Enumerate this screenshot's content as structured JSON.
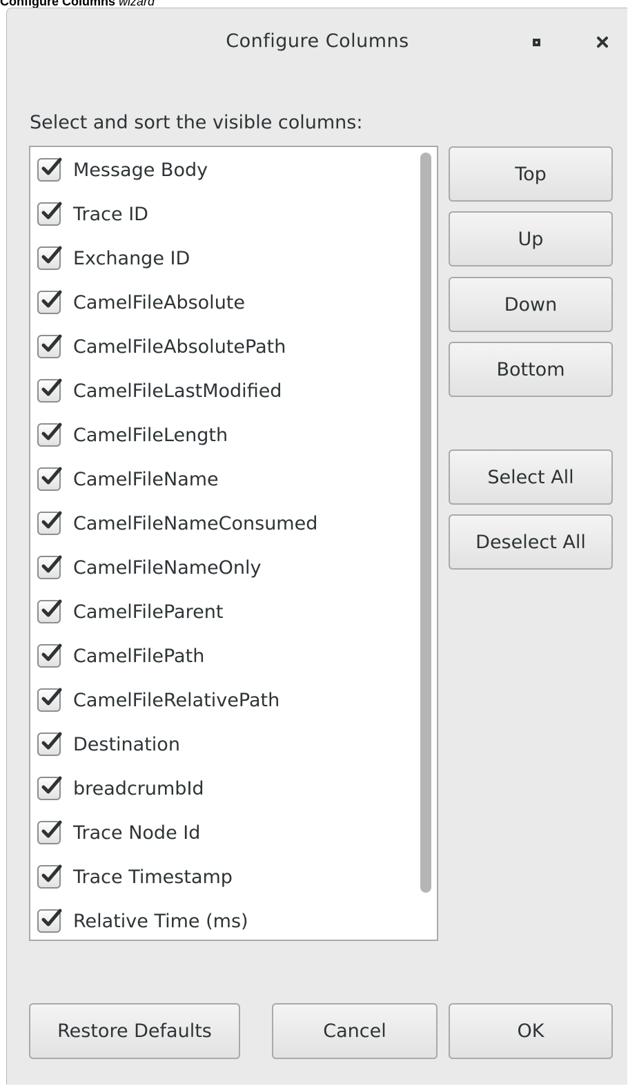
{
  "caption": {
    "bold": "Configure Columns",
    "rest": " wizard"
  },
  "dialog": {
    "title": "Configure Columns",
    "instruction": "Select and sort the visible columns:",
    "icons": {
      "maximize": "maximize-icon",
      "close": "close-icon",
      "checkbox": "check-icon"
    },
    "columns": [
      {
        "label": "Message Body",
        "checked": true
      },
      {
        "label": "Trace ID",
        "checked": true
      },
      {
        "label": "Exchange ID",
        "checked": true
      },
      {
        "label": "CamelFileAbsolute",
        "checked": true
      },
      {
        "label": "CamelFileAbsolutePath",
        "checked": true
      },
      {
        "label": "CamelFileLastModified",
        "checked": true
      },
      {
        "label": "CamelFileLength",
        "checked": true
      },
      {
        "label": "CamelFileName",
        "checked": true
      },
      {
        "label": "CamelFileNameConsumed",
        "checked": true
      },
      {
        "label": "CamelFileNameOnly",
        "checked": true
      },
      {
        "label": "CamelFileParent",
        "checked": true
      },
      {
        "label": "CamelFilePath",
        "checked": true
      },
      {
        "label": "CamelFileRelativePath",
        "checked": true
      },
      {
        "label": "Destination",
        "checked": true
      },
      {
        "label": "breadcrumbId",
        "checked": true
      },
      {
        "label": "Trace Node Id",
        "checked": true
      },
      {
        "label": "Trace Timestamp",
        "checked": true
      },
      {
        "label": "Relative Time (ms)",
        "checked": true
      }
    ],
    "side_buttons": {
      "top": "Top",
      "up": "Up",
      "down": "Down",
      "bottom": "Bottom",
      "select_all": "Select All",
      "deselect_all": "Deselect All"
    },
    "footer_buttons": {
      "restore": "Restore Defaults",
      "cancel": "Cancel",
      "ok": "OK"
    }
  }
}
